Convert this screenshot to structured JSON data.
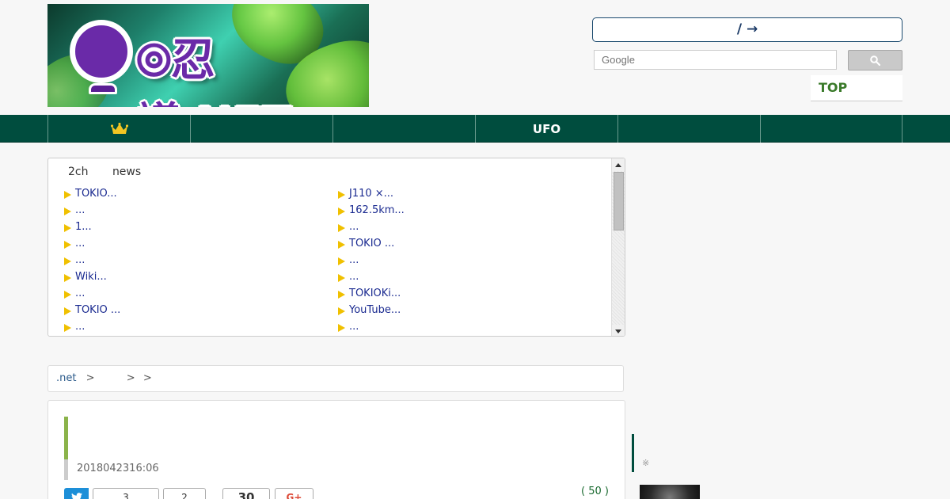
{
  "header": {
    "logo_text": "⦾忍議.NET",
    "search_title": "/ →",
    "search_placeholder": "Google",
    "top_link": "TOP"
  },
  "nav": {
    "items": [
      {
        "label": "",
        "icon": "crown-icon"
      },
      {
        "label": ""
      },
      {
        "label": ""
      },
      {
        "label": "UFO"
      },
      {
        "label": ""
      },
      {
        "label": ""
      }
    ]
  },
  "news": {
    "tabs": [
      "2ch",
      "news"
    ],
    "col1": [
      "TOKIO...",
      "...",
      "1...",
      "...",
      "...",
      "Wiki...",
      "...",
      "TOKIO ...",
      " ..."
    ],
    "col2": [
      "J110 ×...",
      "162.5km...",
      "...",
      "TOKIO ...",
      "...",
      "...",
      "TOKIOKi...",
      "YouTube...",
      "..."
    ]
  },
  "breadcrumb": {
    "items": [
      ".net",
      ">",
      ">",
      ">"
    ]
  },
  "article": {
    "date": "2018042316:06",
    "share": {
      "twitter_count": "3",
      "hatena_count": "2",
      "facebook_count": "30",
      "gplus_label": "G+"
    },
    "comments": "( 50 )"
  },
  "sidebar": {
    "note": "※"
  },
  "colors": {
    "nav_bg": "#004d3e",
    "link": "#1a2a90",
    "accent_green": "#8bb34a",
    "bullet": "#f0c000"
  }
}
